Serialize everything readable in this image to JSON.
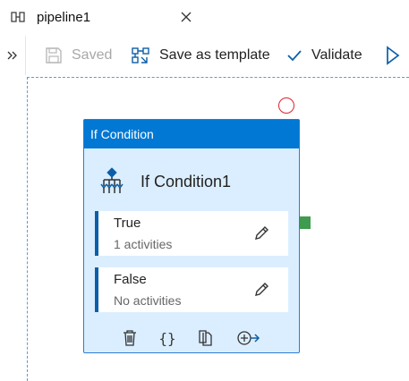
{
  "tab": {
    "title": "pipeline1",
    "icon": "pipeline-icon",
    "close_icon": "close-icon"
  },
  "toolbar": {
    "collapse_icon": "double-chevron-right-icon",
    "saved_label": "Saved",
    "save_template_label": "Save as template",
    "validate_label": "Validate",
    "run_icon": "play-icon"
  },
  "activity": {
    "header": "If Condition",
    "name": "If Condition1",
    "icon": "if-condition-icon",
    "branches": [
      {
        "label": "True",
        "status": "1 activities"
      },
      {
        "label": "False",
        "status": "No activities"
      }
    ],
    "actions": {
      "delete_icon": "trash-icon",
      "code_label": "{}",
      "copy_icon": "copy-icon",
      "add_output_icon": "add-output-icon"
    }
  },
  "colors": {
    "accent": "#0078d4",
    "card_background": "#dbeeff",
    "branch_accent": "#0b5fa8",
    "failure_connector": "#d9232d",
    "success_connector": "#3f9b4f",
    "canvas_border": "#4aa3df"
  }
}
